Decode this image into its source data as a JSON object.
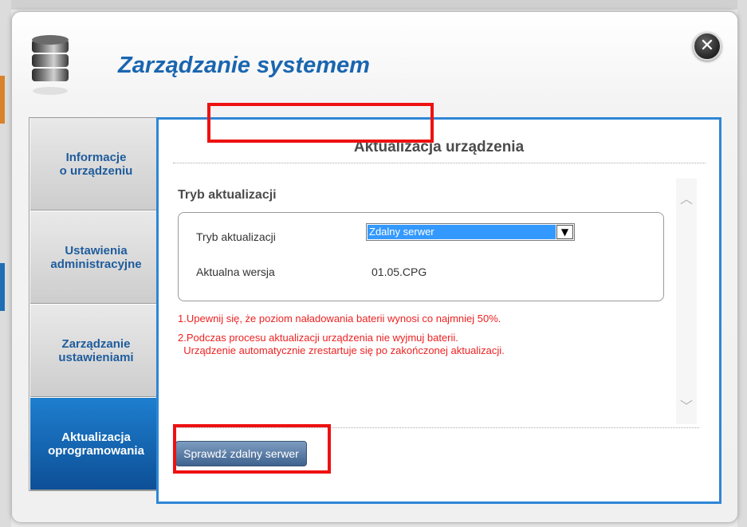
{
  "dialog": {
    "title": "Zarządzanie systemem",
    "close_icon": "close-icon",
    "header_icon": "database-icon"
  },
  "sidebar": {
    "items": [
      {
        "label": "Informacje\no urządzeniu",
        "active": false
      },
      {
        "label": "Ustawienia\nadministracyjne",
        "active": false
      },
      {
        "label": "Zarządzanie\nustawieniami",
        "active": false
      },
      {
        "label": "Aktualizacja\noprogramowania",
        "active": true
      }
    ]
  },
  "panel": {
    "title": "Aktualizacja urządzenia",
    "section_title": "Tryb aktualizacji",
    "mode_label": "Tryb aktualizacji",
    "mode_value": "Zdalny serwer",
    "version_label": "Aktualna wersja",
    "version_value": "01.05.CPG",
    "notes": [
      "1.Upewnij się, że poziom naładowania baterii wynosi co najmniej 50%.",
      "2.Podczas procesu aktualizacji urządzenia nie wyjmuj baterii.",
      "  Urządzenie automatycznie zrestartuje się po zakończonej aktualizacji."
    ],
    "check_button": "Sprawdź zdalny serwer"
  },
  "colors": {
    "accent": "#1a66b0",
    "panel_border": "#2e86d6",
    "note_red": "#ee2222",
    "highlight_red": "#ee1111"
  }
}
